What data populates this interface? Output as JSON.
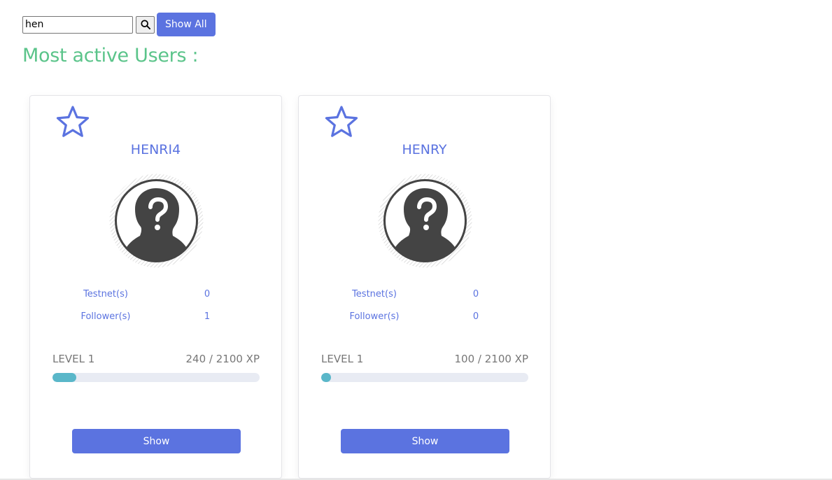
{
  "search": {
    "value": "hen",
    "search_icon": "search-icon",
    "show_all_label": "Show All"
  },
  "page_title": "Most active Users :",
  "colors": {
    "accent": "#5b73e0",
    "title": "#5bc48a",
    "xp_fill": "#5ab7c9",
    "xp_track": "#e8ebf3"
  },
  "cards": [
    {
      "star_icon": "star-outline-icon",
      "username": "HENRI4",
      "avatar_icon": "unknown-user-avatar",
      "stats": [
        {
          "label": "Testnet(s)",
          "value": "0"
        },
        {
          "label": "Follower(s)",
          "value": "1"
        }
      ],
      "level": "LEVEL 1",
      "xp_text": "240 / 2100 XP",
      "xp_progress": 0.114,
      "button_label": "Show"
    },
    {
      "star_icon": "star-outline-icon",
      "username": "HENRY",
      "avatar_icon": "unknown-user-avatar",
      "stats": [
        {
          "label": "Testnet(s)",
          "value": "0"
        },
        {
          "label": "Follower(s)",
          "value": "0"
        }
      ],
      "level": "LEVEL 1",
      "xp_text": "100 / 2100 XP",
      "xp_progress": 0.048,
      "button_label": "Show"
    }
  ]
}
